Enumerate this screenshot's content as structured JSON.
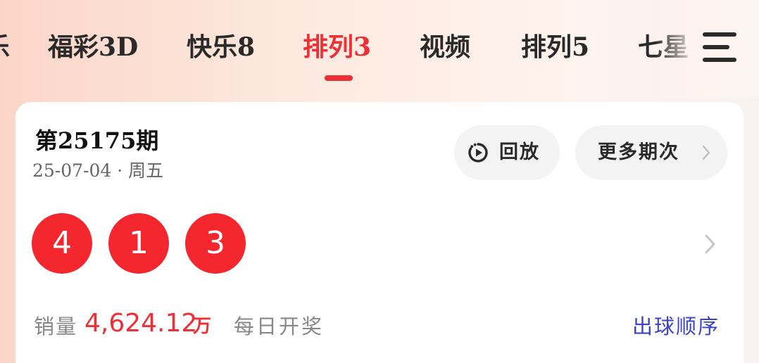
{
  "tabs": {
    "items": [
      {
        "label": "乐"
      },
      {
        "label": "福彩3D"
      },
      {
        "label": "快乐8"
      },
      {
        "label": "排列3"
      },
      {
        "label": "视频"
      },
      {
        "label": "排列5"
      },
      {
        "label": "七星"
      }
    ],
    "active_index": 3,
    "menu_icon": "hamburger-menu-icon"
  },
  "draw": {
    "issue": "第25175期",
    "date": "25-07-04 · 周五",
    "replay_label": "回放",
    "replay_icon": "replay-timer-icon",
    "more_label": "更多期次",
    "balls": [
      "4",
      "1",
      "3"
    ],
    "sales_label": "销量",
    "sales_value": "4,624.12",
    "sales_unit": "万",
    "frequency": "每日开奖",
    "order_link": "出球顺序"
  },
  "colors": {
    "accent": "#ef2f36",
    "ball": "#f4272f",
    "link": "#3a43c9"
  }
}
